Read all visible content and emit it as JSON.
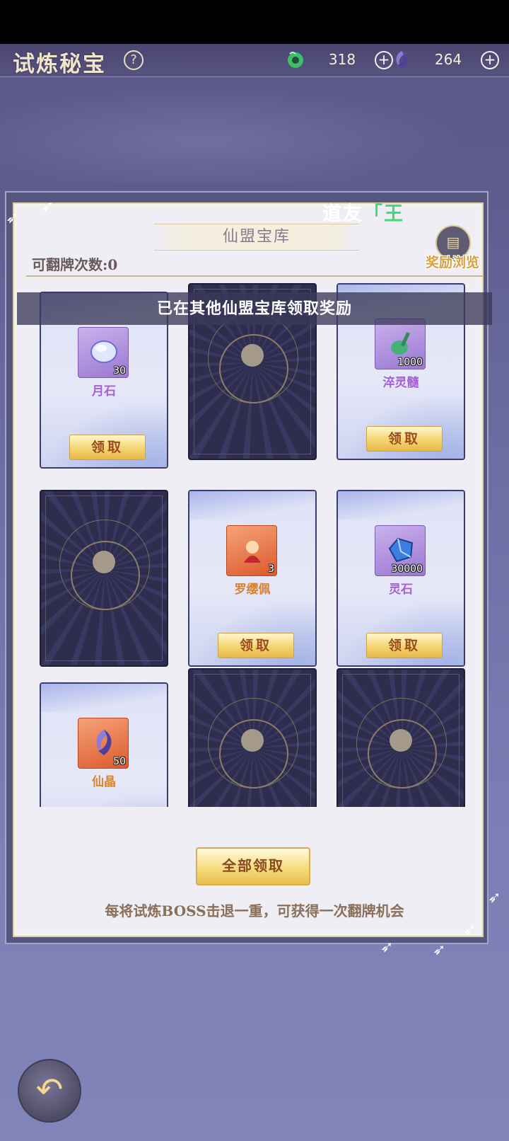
{
  "header": {
    "title": "试炼秘宝",
    "help_label": "?",
    "resources": [
      {
        "icon": "jade-currency-icon",
        "value": "318",
        "plus": "+"
      },
      {
        "icon": "crystal-currency-icon",
        "value": "264",
        "plus": "+"
      }
    ]
  },
  "panel": {
    "greeting_prefix": "道友",
    "greeting_name": "「王",
    "banner_title": "仙盟宝库",
    "flip_count": "可翻牌次数:0",
    "reward_preview_label": "奖励浏览",
    "notice": "已在其他仙盟宝库领取奖励",
    "claim_all_label": "全部领取",
    "hint": "每将试炼BOSS击退一重，可获得一次翻牌机会"
  },
  "cards": [
    {
      "state": "revealed",
      "item_name": "月石",
      "qty": "30",
      "rarity": "purple",
      "claim_label": "领取",
      "icon": "moonstone-icon"
    },
    {
      "state": "hidden"
    },
    {
      "state": "revealed",
      "item_name": "淬灵髓",
      "qty": "1000",
      "rarity": "purple",
      "claim_label": "领取",
      "icon": "jade-pipa-icon"
    },
    {
      "state": "hidden"
    },
    {
      "state": "revealed",
      "item_name": "罗缨佩",
      "qty": "3",
      "rarity": "orange",
      "claim_label": "领取",
      "icon": "pendant-icon"
    },
    {
      "state": "revealed",
      "item_name": "灵石",
      "qty": "30000",
      "rarity": "purple",
      "claim_label": "领取",
      "icon": "spirit-stone-icon"
    },
    {
      "state": "revealed",
      "item_name": "仙晶",
      "qty": "50",
      "rarity": "orange",
      "claim_label": "",
      "icon": "immortal-crystal-icon"
    },
    {
      "state": "hidden"
    },
    {
      "state": "hidden"
    }
  ],
  "colors": {
    "accent_gold": "#f4d56e",
    "name_green": "#3ddc74",
    "purple_rarity": "#a85fd6",
    "orange_rarity": "#d9822b"
  }
}
